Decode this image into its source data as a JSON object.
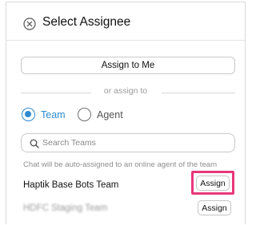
{
  "header": {
    "title": "Select Assignee",
    "close_icon": "close-circle-icon"
  },
  "assign_to_me_label": "Assign to Me",
  "divider_text": "or assign to",
  "assignee_type": {
    "options": [
      {
        "label": "Team",
        "selected": true
      },
      {
        "label": "Agent",
        "selected": false
      }
    ],
    "accent_color": "#2e8bd0"
  },
  "search": {
    "placeholder": "Search Teams",
    "value": "",
    "icon": "search-icon"
  },
  "hint": "Chat will be auto-assigned to an online agent of the team",
  "teams": [
    {
      "name": "Haptik Base Bots Team",
      "button_label": "Assign",
      "highlighted": true
    },
    {
      "name": "HDFC Staging Team",
      "button_label": "Assign",
      "highlighted": false,
      "obscured": true
    }
  ],
  "highlight_color": "#e8387a"
}
